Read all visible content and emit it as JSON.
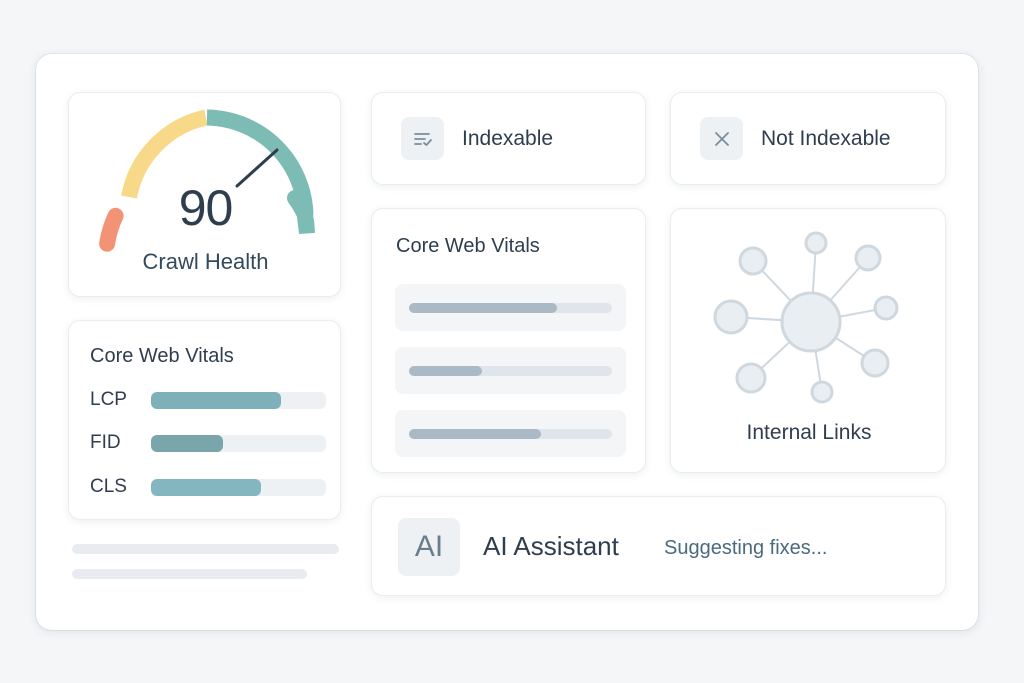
{
  "crawl_health": {
    "score": "90",
    "label": "Crawl Health",
    "score_fraction": 0.9,
    "colors": {
      "low": "#f39375",
      "mid": "#f8d98a",
      "high": "#7dbcb4",
      "needle": "#2f3e4e"
    }
  },
  "core_web_vitals_left": {
    "title": "Core Web Vitals",
    "metrics": [
      {
        "label": "LCP",
        "value": 0.74,
        "color": "#7db0b9"
      },
      {
        "label": "FID",
        "value": 0.41,
        "color": "#78a6ab"
      },
      {
        "label": "CLS",
        "value": 0.63,
        "color": "#84b6c0"
      }
    ]
  },
  "indexable": {
    "label": "Indexable",
    "icon": "sort-list-icon"
  },
  "not_indexable": {
    "label": "Not Indexable",
    "icon": "close-icon"
  },
  "core_web_vitals_mid": {
    "title": "Core Web Vitals",
    "bars": [
      0.73,
      0.36,
      0.65
    ]
  },
  "internal_links": {
    "label": "Internal Links",
    "icon": "network-graph-icon"
  },
  "ai_assistant": {
    "badge": "AI",
    "title": "AI Assistant",
    "status": "Suggesting fixes..."
  }
}
